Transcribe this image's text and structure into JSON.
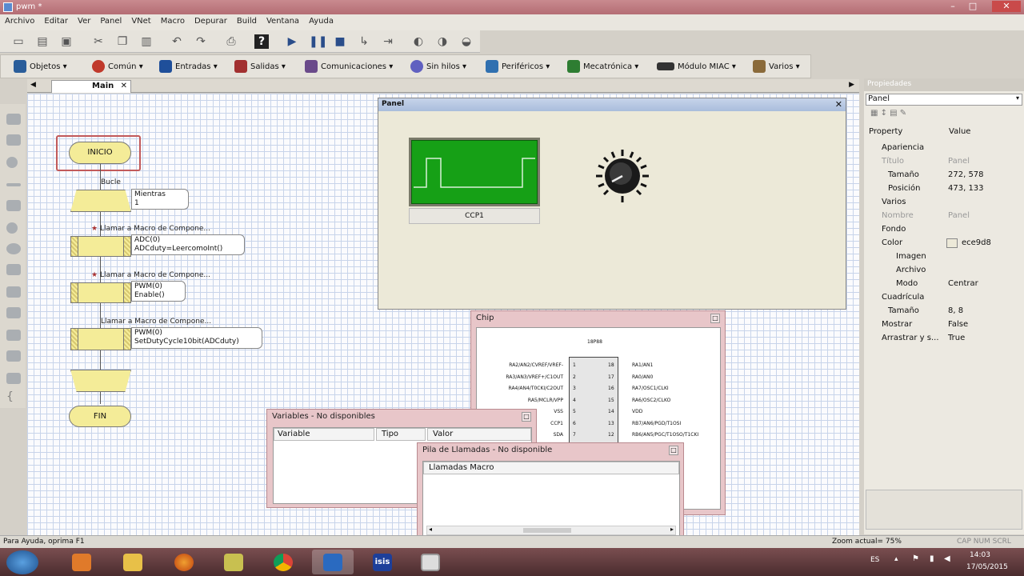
{
  "window": {
    "title": "pwm *"
  },
  "menu": [
    "Archivo",
    "Editar",
    "Ver",
    "Panel",
    "VNet",
    "Macro",
    "Depurar",
    "Build",
    "Ventana",
    "Ayuda"
  ],
  "toolbar_components": [
    {
      "label": "Objetos",
      "icon": "objects-icon",
      "color": "#2a5d9a"
    },
    {
      "label": "Común",
      "icon": "common-icon",
      "color": "#c0392b"
    },
    {
      "label": "Entradas",
      "icon": "inputs-icon",
      "color": "#1f4f9a"
    },
    {
      "label": "Salidas",
      "icon": "outputs-icon",
      "color": "#a23030"
    },
    {
      "label": "Comunicaciones",
      "icon": "comms-icon",
      "color": "#6a4a8a"
    },
    {
      "label": "Sin hilos",
      "icon": "wireless-icon",
      "color": "#6060c0"
    },
    {
      "label": "Periféricos",
      "icon": "peripherals-icon",
      "color": "#3070b0"
    },
    {
      "label": "Mecatrónica",
      "icon": "mechatronics-icon",
      "color": "#2e7d32"
    },
    {
      "label": "Módulo MIAC",
      "icon": "miac-icon",
      "color": "#333333"
    },
    {
      "label": "Varios",
      "icon": "misc-icon",
      "color": "#8a6a3a"
    }
  ],
  "tabs": {
    "main": "Main"
  },
  "flowchart": {
    "start": "INICIO",
    "loop_label": "Bucle",
    "loop_note": [
      "Mientras",
      "1"
    ],
    "macro1_caption": "Llamar a Macro de Compone...",
    "macro1_note": [
      "ADC(0)",
      "ADCduty=LeercomoInt()"
    ],
    "macro2_caption": "Llamar a Macro de Compone...",
    "macro2_note": [
      "PWM(0)",
      "Enable()"
    ],
    "macro3_caption": "Llamar a Macro de Compone...",
    "macro3_note": [
      "PWM(0)",
      "SetDutyCycle10bit(ADCduty)"
    ],
    "end": "FIN"
  },
  "panel_window": {
    "title": "Panel",
    "scope_label": "CCP1",
    "bg_color": "#ece9d8"
  },
  "chip_window": {
    "title": "Chip",
    "chip_name": "18P88",
    "left_pins": [
      "RA2/AN2/CVREF/VREF-",
      "RA3/AN3/VREF+/C1OUT",
      "RA4/AN4/T0CKI/C2OUT",
      "RA5/MCLR/VPP",
      "VSS",
      "CCP1",
      "SDA"
    ],
    "left_nums": [
      "1",
      "2",
      "3",
      "4",
      "5",
      "6",
      "7"
    ],
    "right_pins": [
      "RA1/AN1",
      "RA0/AN0",
      "RA7/OSC1/CLKI",
      "RA6/OSC2/CLKO",
      "VDD",
      "RB7/AN6/PGD/T1OSI",
      "RB6/AN5/PGC/T1OSO/T1CKI"
    ],
    "right_nums": [
      "18",
      "17",
      "16",
      "15",
      "14",
      "13",
      "12"
    ]
  },
  "variables_window": {
    "title": "Variables - No disponibles",
    "columns": [
      "Variable",
      "Tipo",
      "Valor"
    ]
  },
  "callstack_window": {
    "title": "Pila de Llamadas - No disponible",
    "columns": [
      "Llamadas Macro"
    ]
  },
  "properties": {
    "title": "Propiedades",
    "selected": "Panel",
    "col_property": "Property",
    "col_value": "Value",
    "rows": [
      {
        "k": "Apariencia",
        "v": "",
        "group": true
      },
      {
        "k": "Título",
        "v": "Panel",
        "dim": true
      },
      {
        "k": "Tamaño",
        "v": "272, 578"
      },
      {
        "k": "Posición",
        "v": "473, 133"
      },
      {
        "k": "Varios",
        "v": "",
        "group": true
      },
      {
        "k": "Nombre",
        "v": "Panel",
        "dim": true
      },
      {
        "k": "Fondo",
        "v": "",
        "group": true
      },
      {
        "k": "Color",
        "v": "ece9d8"
      },
      {
        "k": "Imagen",
        "v": "",
        "group": true
      },
      {
        "k": "Archivo",
        "v": ""
      },
      {
        "k": "Modo",
        "v": "Centrar"
      },
      {
        "k": "Cuadrícula",
        "v": "",
        "group": true
      },
      {
        "k": "Tamaño",
        "v": "8, 8"
      },
      {
        "k": "Mostrar",
        "v": "False"
      },
      {
        "k": "Arrastrar y s...",
        "v": "True"
      }
    ]
  },
  "status": {
    "help": "Para Ayuda, oprima F1",
    "zoom": "Zoom actual= 75%",
    "keys": "CAP  NUM  SCRL"
  },
  "taskbar": {
    "lang": "ES",
    "time": "14:03",
    "date": "17/05/2015",
    "isis_label": "isis"
  }
}
